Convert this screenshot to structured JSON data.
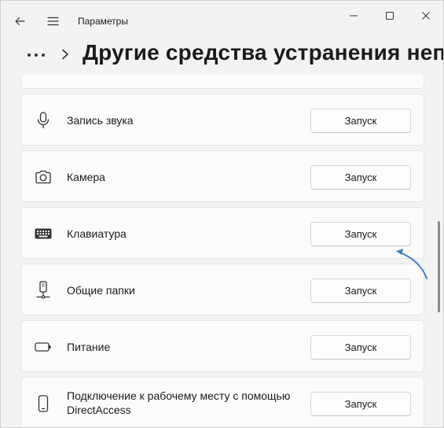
{
  "window": {
    "app_title": "Параметры",
    "icons": {
      "back": "back-arrow-icon",
      "menu": "hamburger-menu-icon",
      "minimize": "minimize-icon",
      "maximize": "maximize-icon",
      "close": "close-icon"
    }
  },
  "header": {
    "overflow_icon": "more-dots-icon",
    "separator_icon": "chevron-right-icon",
    "title": "Другие средства устранения непол"
  },
  "items": [
    {
      "label": "Запись звука",
      "icon": "microphone-icon",
      "button": "Запуск"
    },
    {
      "label": "Камера",
      "icon": "camera-icon",
      "button": "Запуск"
    },
    {
      "label": "Клавиатура",
      "icon": "keyboard-icon",
      "button": "Запуск"
    },
    {
      "label": "Общие папки",
      "icon": "shared-folder-icon",
      "button": "Запуск"
    },
    {
      "label": "Питание",
      "icon": "battery-icon",
      "button": "Запуск"
    },
    {
      "label_line1": "Подключение к рабочему месту с помощью",
      "label_line2": "DirectAccess",
      "icon": "phone-device-icon",
      "button": "Запуск"
    }
  ],
  "annotation": {
    "color": "#4a7fc1",
    "target": "Клавиатура"
  }
}
